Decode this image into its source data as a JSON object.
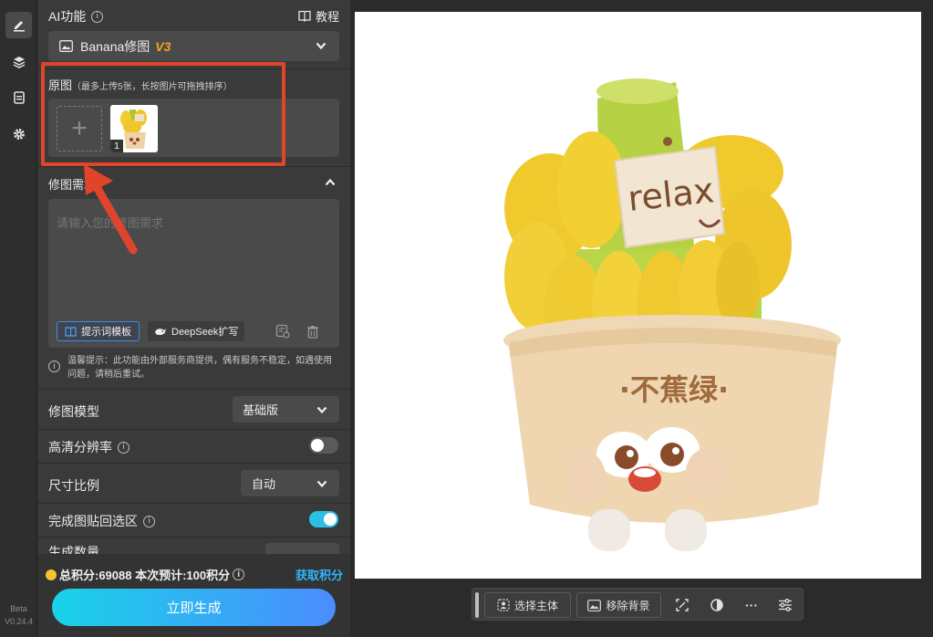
{
  "rail": {
    "items": [
      {
        "icon": "pencil-edit-icon",
        "active": true
      },
      {
        "icon": "layers-icon",
        "active": false
      },
      {
        "icon": "clipboard-icon",
        "active": false
      },
      {
        "icon": "gear-icon",
        "active": false
      }
    ],
    "version_line1": "Beta",
    "version_line2": "V0.24.4"
  },
  "header": {
    "title": "AI功能",
    "tutorial_label": "教程"
  },
  "model_select": {
    "label": "Banana修图",
    "badge": "V3"
  },
  "source": {
    "title": "原图",
    "hint": "（最多上传5张，长按图片可拖拽排序）",
    "add_symbol": "+",
    "thumbnails": [
      {
        "index": "1"
      }
    ]
  },
  "requirement": {
    "title": "修图需求",
    "placeholder": "请输入您的修图需求",
    "template_button": "提示词模板",
    "deepseek_button": "DeepSeek扩写"
  },
  "notice": "温馨提示：此功能由外部服务商提供，偶有服务不稳定，如遇使用问题，请稍后重试。",
  "settings": {
    "model_label": "修图模型",
    "model_value": "基础版",
    "hd_label": "高清分辨率",
    "hd_on": false,
    "ratio_label": "尺寸比例",
    "ratio_value": "自动",
    "paste_label": "完成图贴回选区",
    "paste_on": true,
    "count_label": "生成数量"
  },
  "footer": {
    "points_text": "总积分:69088 本次预计:100积分",
    "get_points": "获取积分",
    "generate_button": "立即生成"
  },
  "canvas": {
    "tag_text": "relax",
    "pot_text": "·不蕉绿·"
  },
  "toolbar": {
    "select_subject": "选择主体",
    "remove_bg": "移除背景",
    "more": "···"
  },
  "colors": {
    "accent_gradient_start": "#19d3e8",
    "accent_gradient_end": "#4b8cff",
    "get_points": "#2fb6ff",
    "toggle_on": "#2bbfe6",
    "annotation": "#e0452c",
    "v3_badge": "#f2a51c"
  }
}
